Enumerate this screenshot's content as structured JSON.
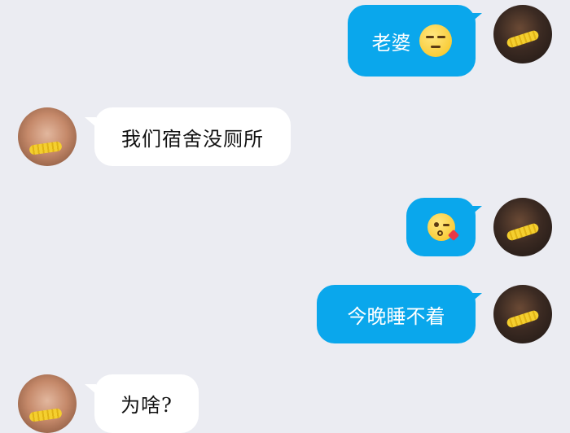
{
  "messages": [
    {
      "sender": "me",
      "text": "老婆",
      "emoji": "unamused-face-icon"
    },
    {
      "sender": "her",
      "text": "我们宿舍没厕所"
    },
    {
      "sender": "me",
      "text": "",
      "emoji": "face-blowing-kiss-icon"
    },
    {
      "sender": "me",
      "text": "今晚睡不着"
    },
    {
      "sender": "her",
      "text": "为啥?"
    }
  ],
  "colors": {
    "background": "#ebecf2",
    "sent_bubble": "#0aa7ec",
    "received_bubble": "#ffffff"
  }
}
